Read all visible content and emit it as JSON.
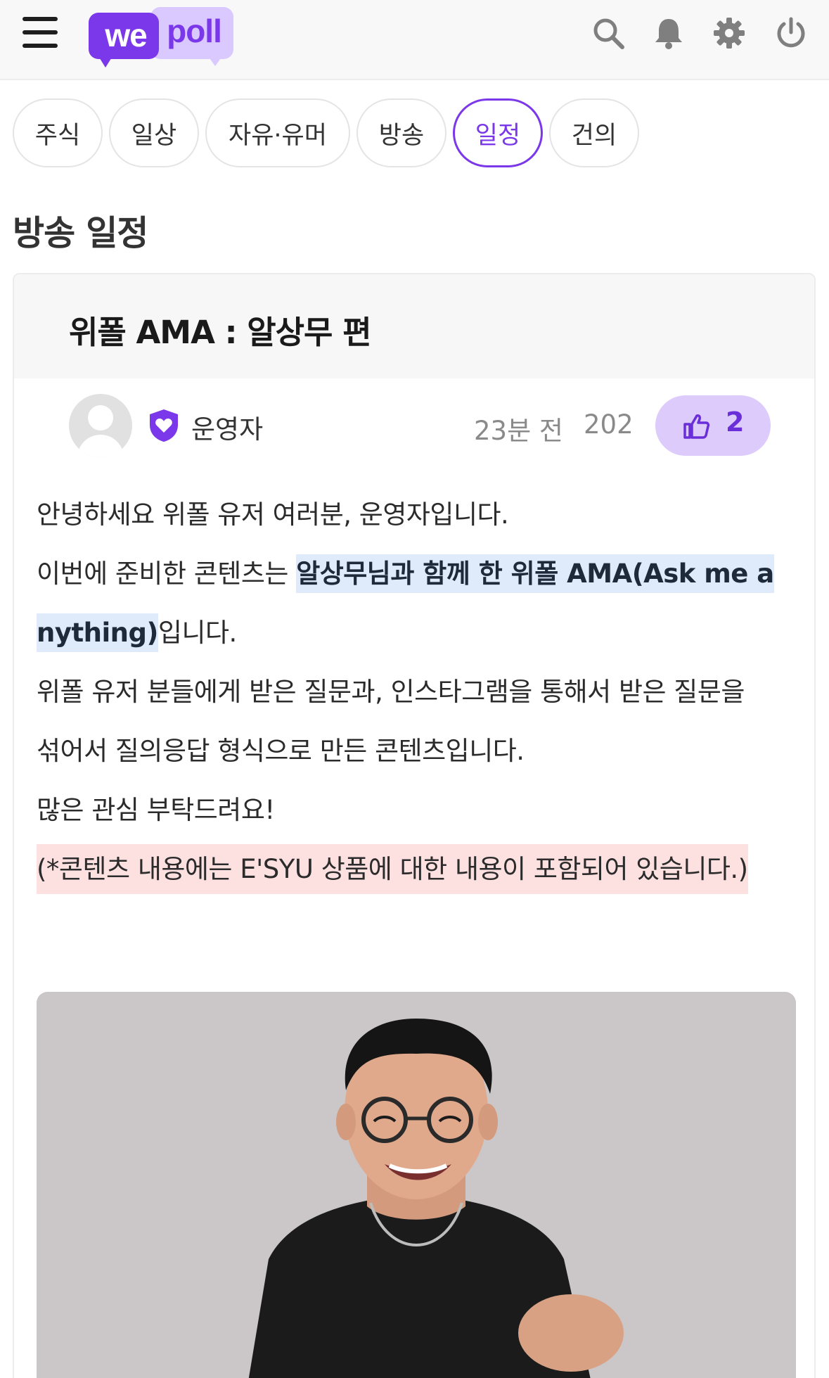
{
  "header": {
    "logo_we": "we",
    "logo_poll": "poll"
  },
  "tabs": [
    {
      "label": "주식",
      "active": false
    },
    {
      "label": "일상",
      "active": false
    },
    {
      "label": "자유·유머",
      "active": false
    },
    {
      "label": "방송",
      "active": false
    },
    {
      "label": "일정",
      "active": true
    },
    {
      "label": "건의",
      "active": false
    }
  ],
  "section": {
    "title": "방송 일정"
  },
  "post": {
    "title": "위폴 AMA : 알상무 편",
    "author": "운영자",
    "time": "23분 전",
    "views": "202",
    "likes": "2",
    "body": {
      "line1": "안녕하세요 위폴 유저 여러분, 운영자입니다.",
      "line2_prefix": "이번에 준비한 콘텐츠는 ",
      "line2_highlight": "알상무님과 함께 한 위폴 AMA(Ask me a",
      "line3_highlight": "nything)",
      "line3_suffix": "입니다.",
      "line4": "위폴 유저 분들에게 받은 질문과, 인스타그램을 통해서 받은 질문을",
      "line5": "섞어서 질의응답 형식으로 만든 콘텐츠입니다.",
      "line6": "많은 관심 부탁드려요!",
      "notice": "(*콘텐츠 내용에는 E'SYU 상품에 대한 내용이 포함되어 있습니다.)"
    }
  },
  "colors": {
    "brand": "#7b38ea",
    "brand_light": "#d9c9ff",
    "like_bg": "#dccbfb",
    "highlight_blue": "#dfeafb",
    "highlight_pink": "#fde0e0"
  },
  "icons": {
    "menu": "hamburger-icon",
    "search": "search-icon",
    "notifications": "bell-icon",
    "settings": "gear-icon",
    "logout": "power-icon",
    "badge": "shield-heart-icon",
    "like": "thumbs-up-icon"
  }
}
